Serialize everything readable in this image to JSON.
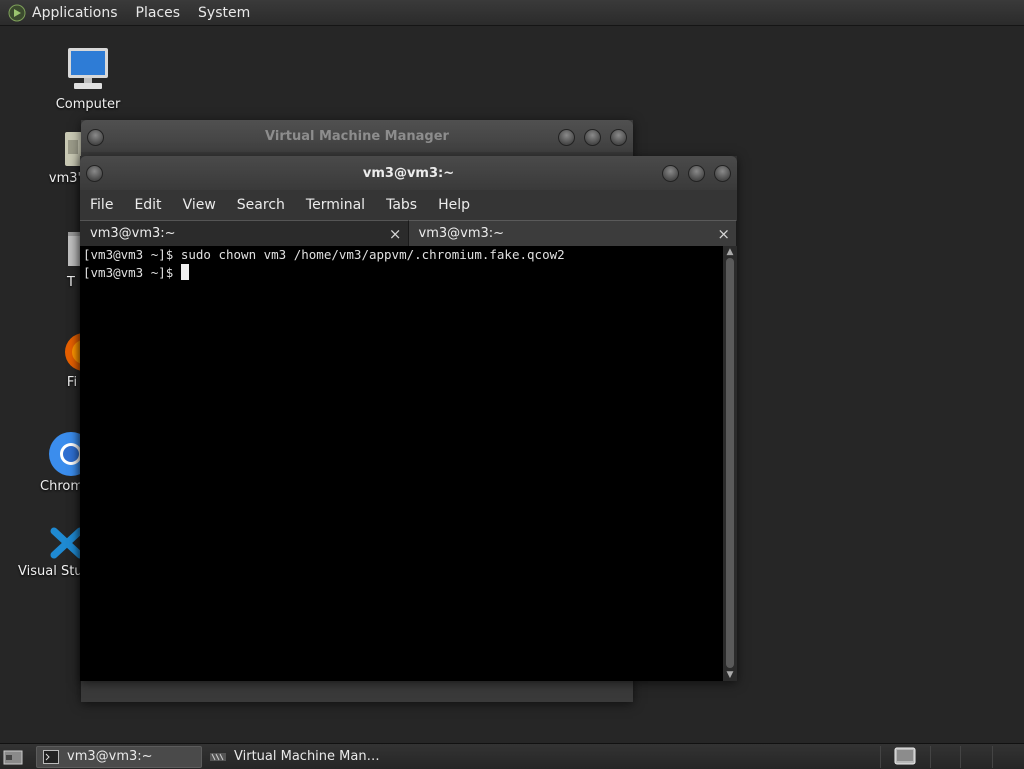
{
  "top_panel": {
    "menus": [
      "Applications",
      "Places",
      "System"
    ]
  },
  "desktop": {
    "icons": [
      {
        "label": "Computer",
        "icon": "computer-icon"
      },
      {
        "label": "vm3'",
        "icon": "home-folder-icon"
      },
      {
        "label": "T",
        "icon": "trash-icon"
      },
      {
        "label": "Fi",
        "icon": "firefox-icon"
      },
      {
        "label": "Chrom",
        "icon": "chromium-icon"
      },
      {
        "label": "Visual Stu",
        "icon": "vscode-icon"
      }
    ]
  },
  "vmm_window": {
    "title": "Virtual Machine Manager"
  },
  "terminal_window": {
    "title": "vm3@vm3:~",
    "menu": [
      "File",
      "Edit",
      "View",
      "Search",
      "Terminal",
      "Tabs",
      "Help"
    ],
    "tabs": [
      {
        "label": "vm3@vm3:~",
        "close": "×"
      },
      {
        "label": "vm3@vm3:~",
        "close": "×"
      }
    ],
    "lines": [
      "[vm3@vm3 ~]$ sudo chown vm3 /home/vm3/appvm/.chromium.fake.qcow2",
      "[vm3@vm3 ~]$ "
    ]
  },
  "bottom_panel": {
    "tasks": [
      {
        "label": "vm3@vm3:~",
        "icon": "terminal-icon"
      },
      {
        "label": "Virtual Machine Man…",
        "icon": "vmm-icon"
      }
    ]
  },
  "colors": {
    "desktop_bg": "#262626",
    "panel_bg": "#2b2b2b",
    "terminal_bg": "#000000"
  }
}
